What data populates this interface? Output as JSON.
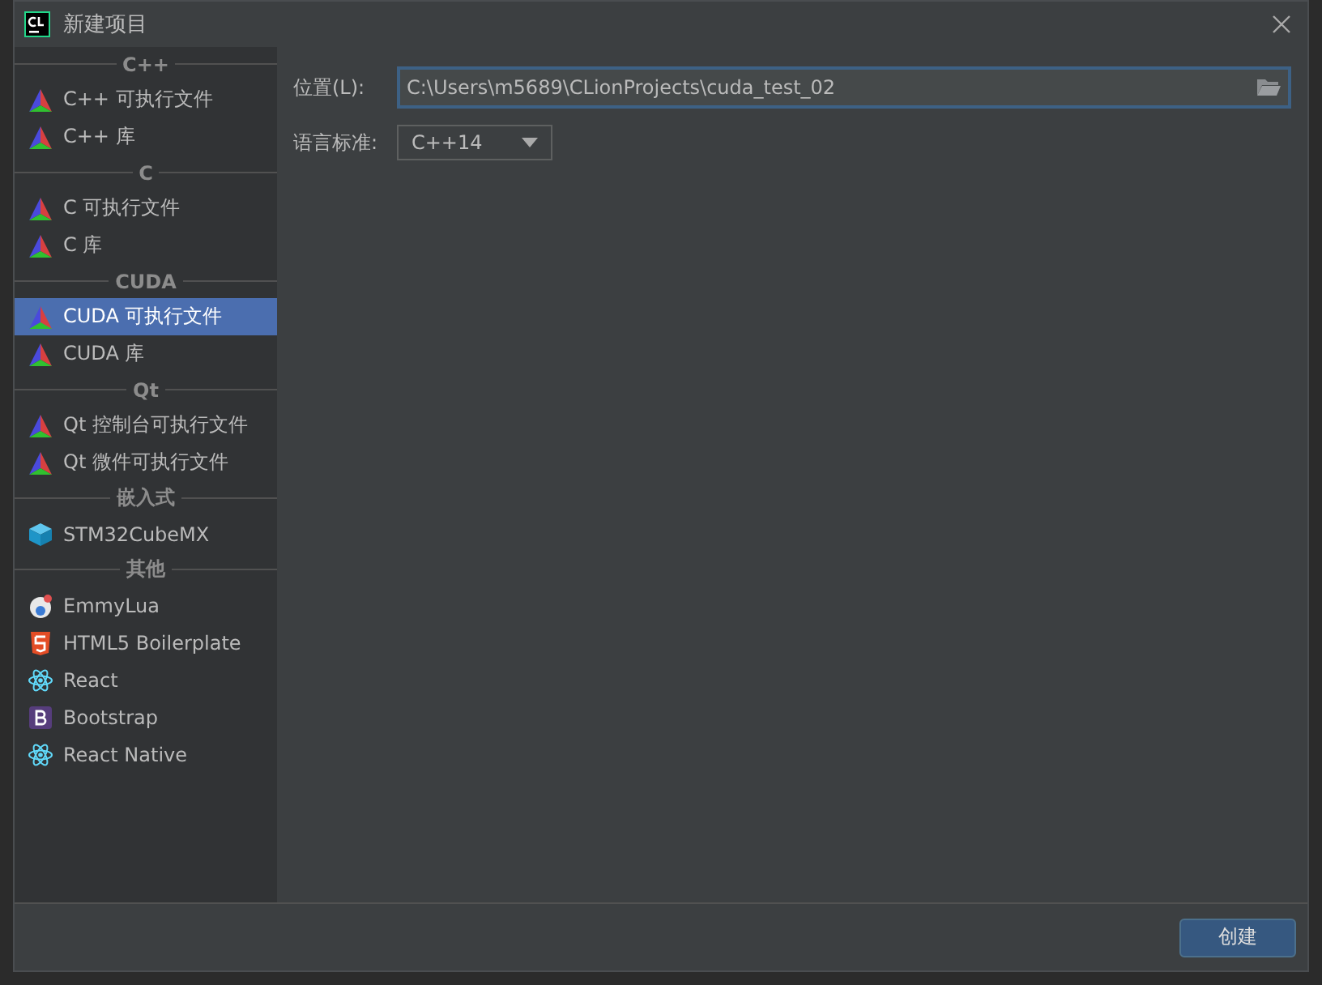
{
  "window": {
    "title": "新建项目"
  },
  "sidebar": {
    "groups": [
      {
        "header": "C++",
        "items": [
          {
            "label": "C++ 可执行文件",
            "kind": "triangle",
            "selected": false
          },
          {
            "label": "C++ 库",
            "kind": "triangle",
            "selected": false
          }
        ]
      },
      {
        "header": "C",
        "items": [
          {
            "label": "C 可执行文件",
            "kind": "triangle",
            "selected": false
          },
          {
            "label": "C 库",
            "kind": "triangle",
            "selected": false
          }
        ]
      },
      {
        "header": "CUDA",
        "items": [
          {
            "label": "CUDA 可执行文件",
            "kind": "triangle",
            "selected": true
          },
          {
            "label": "CUDA 库",
            "kind": "triangle",
            "selected": false
          }
        ]
      },
      {
        "header": "Qt",
        "items": [
          {
            "label": "Qt 控制台可执行文件",
            "kind": "triangle",
            "selected": false
          },
          {
            "label": "Qt 微件可执行文件",
            "kind": "triangle",
            "selected": false
          }
        ]
      },
      {
        "header": "嵌入式",
        "items": [
          {
            "label": "STM32CubeMX",
            "kind": "cube",
            "selected": false
          }
        ]
      },
      {
        "header": "其他",
        "items": [
          {
            "label": "EmmyLua",
            "kind": "lua",
            "selected": false
          },
          {
            "label": "HTML5 Boilerplate",
            "kind": "html5",
            "selected": false
          },
          {
            "label": "React",
            "kind": "atom",
            "selected": false
          },
          {
            "label": "Bootstrap",
            "kind": "bootstrap",
            "selected": false
          },
          {
            "label": "React Native",
            "kind": "atom",
            "selected": false
          }
        ]
      }
    ]
  },
  "form": {
    "location": {
      "label": "位置(L):",
      "value": "C:\\Users\\m5689\\CLionProjects\\cuda_test_02"
    },
    "language_standard": {
      "label": "语言标准:",
      "value": "C++14"
    }
  },
  "buttons": [
    "创建"
  ]
}
